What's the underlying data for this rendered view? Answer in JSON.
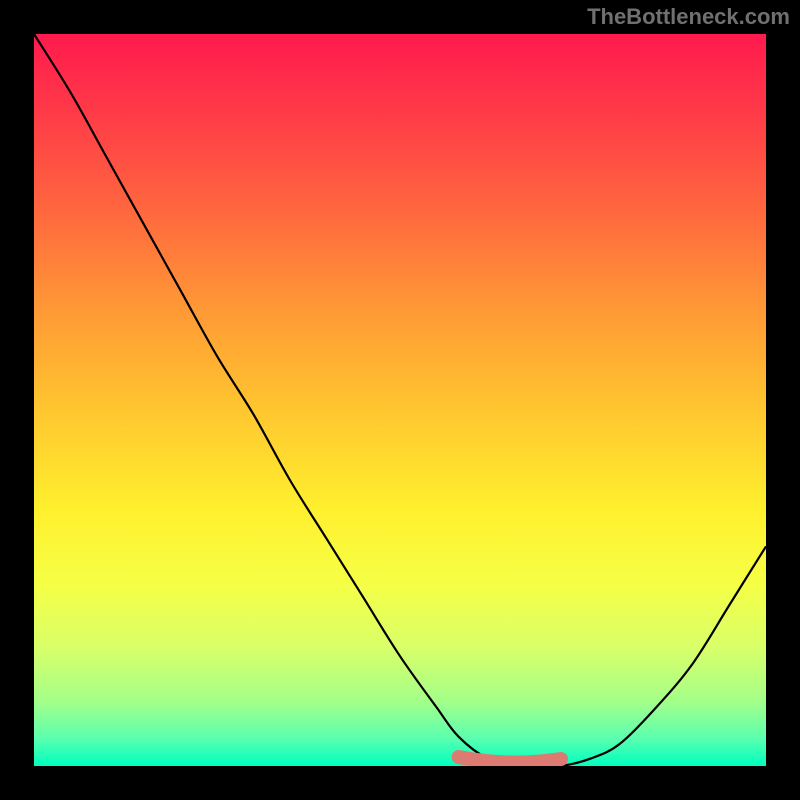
{
  "watermark": "TheBottleneck.com",
  "chart_data": {
    "type": "line",
    "title": "",
    "xlabel": "",
    "ylabel": "",
    "xlim": [
      0,
      100
    ],
    "ylim": [
      0,
      100
    ],
    "grid": false,
    "series": [
      {
        "name": "bottleneck-curve",
        "x": [
          0,
          5,
          10,
          15,
          20,
          25,
          30,
          35,
          40,
          45,
          50,
          55,
          58,
          62,
          66,
          69,
          72,
          76,
          80,
          85,
          90,
          95,
          100
        ],
        "y": [
          100,
          92,
          83,
          74,
          65,
          56,
          48,
          39,
          31,
          23,
          15,
          8,
          4,
          1,
          0,
          0,
          0,
          1,
          3,
          8,
          14,
          22,
          30
        ]
      }
    ],
    "annotations": [
      {
        "name": "optimal-range",
        "x_range": [
          58,
          72
        ],
        "y": 0,
        "color": "#dd7a72"
      }
    ],
    "background_gradient": {
      "type": "vertical",
      "stops": [
        {
          "pos": 0,
          "color": "#ff1a4d"
        },
        {
          "pos": 50,
          "color": "#ffc82f"
        },
        {
          "pos": 75,
          "color": "#f6ff45"
        },
        {
          "pos": 100,
          "color": "#00ffc0"
        }
      ]
    }
  }
}
